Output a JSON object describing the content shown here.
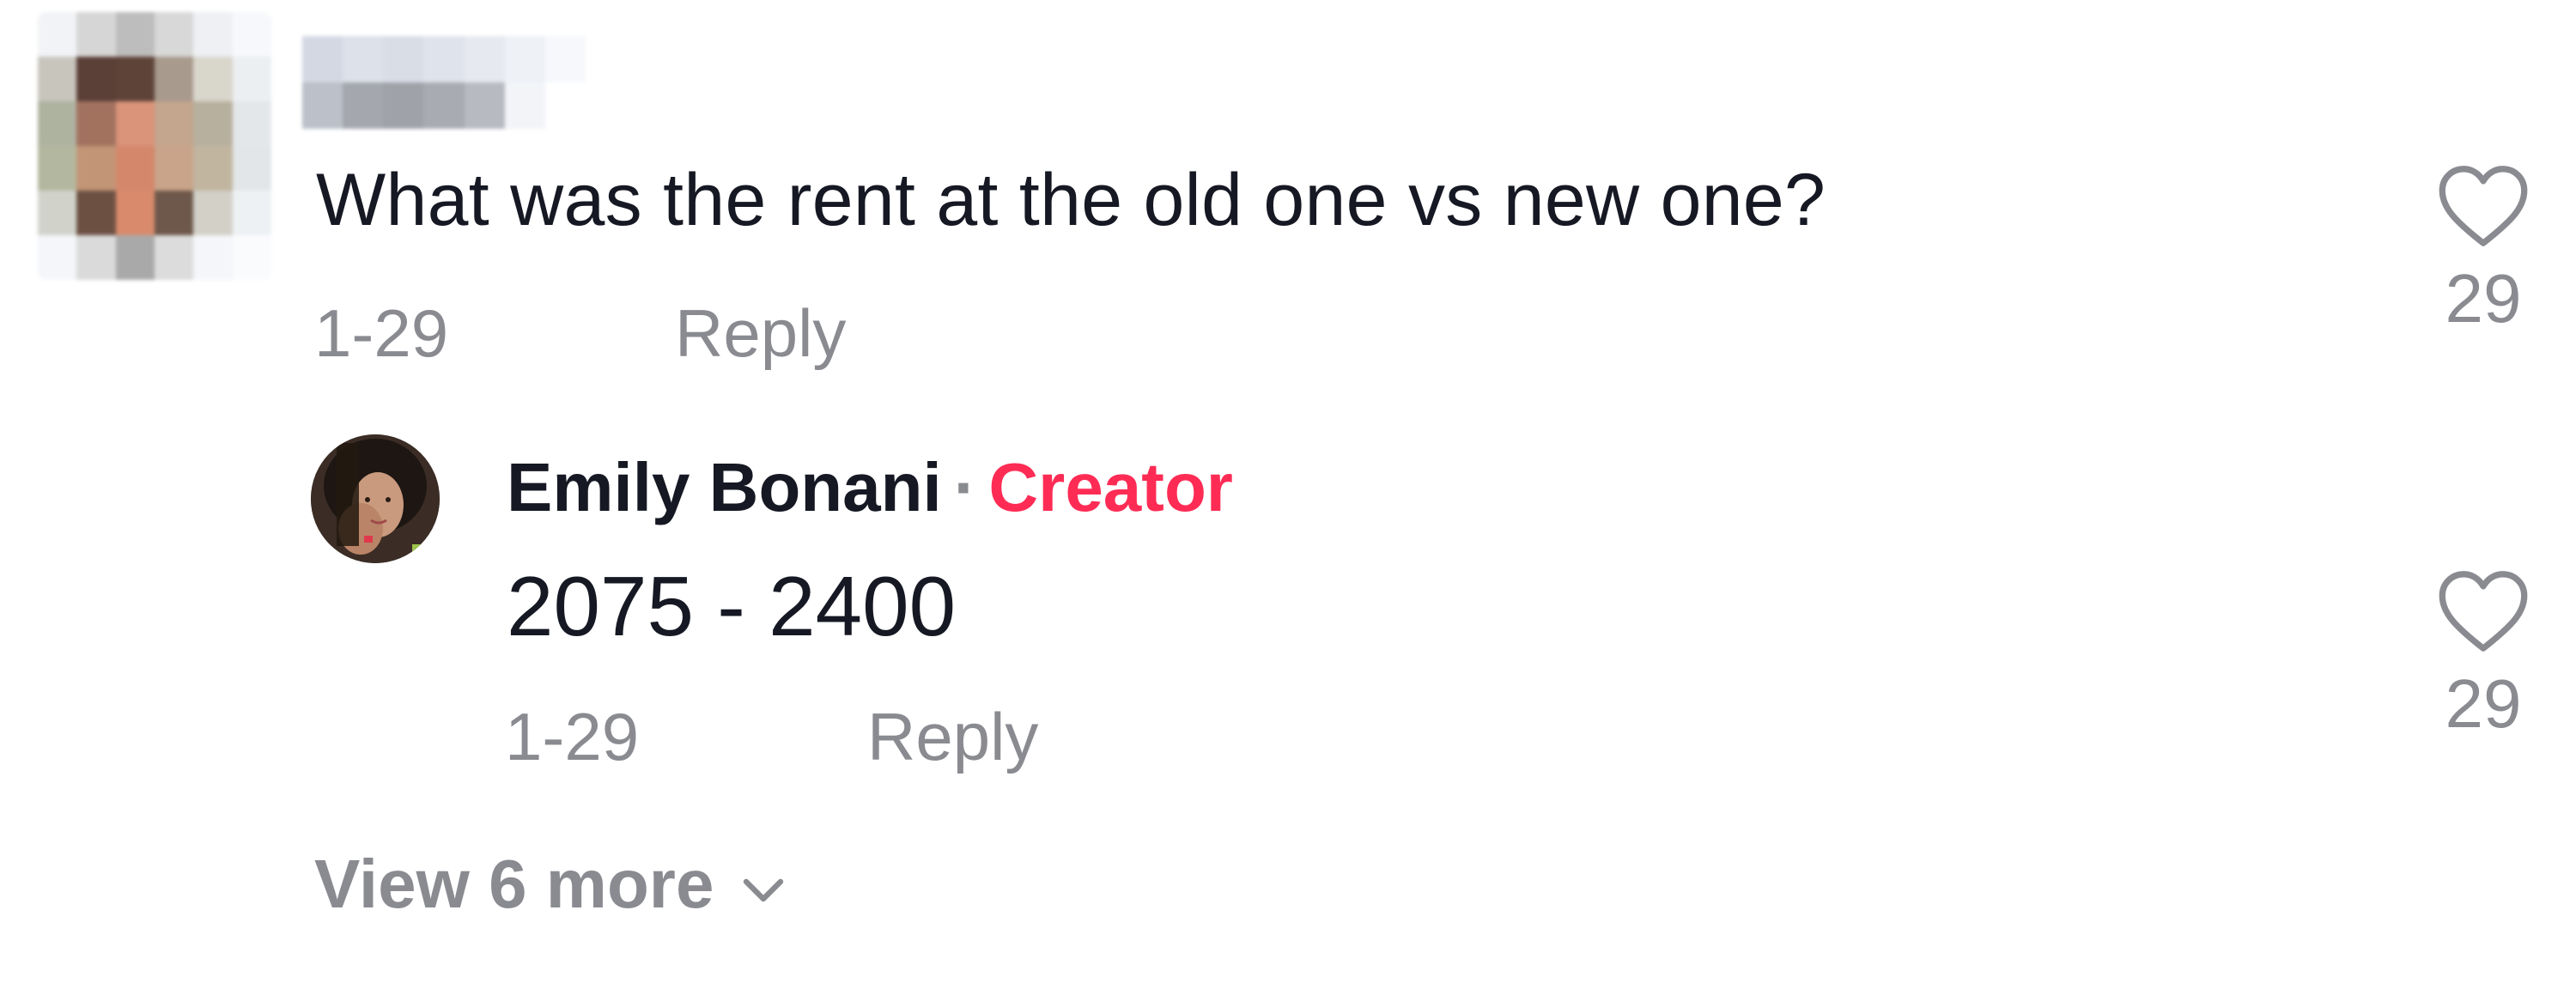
{
  "comment": {
    "avatar_icon": "pixelated-avatar",
    "username_censored": true,
    "text": "What was the rent at the old one vs new one?",
    "date": "1-29",
    "reply_label": "Reply",
    "like_icon": "heart-outline-icon",
    "like_count": "29"
  },
  "reply": {
    "avatar_icon": "profile-photo",
    "author": "Emily Bonani",
    "separator": "·",
    "badge": "Creator",
    "text": "2075 - 2400",
    "date": "1-29",
    "reply_label": "Reply",
    "like_icon": "heart-outline-icon",
    "like_count": "29"
  },
  "view_more": {
    "label": "View 6 more",
    "icon": "chevron-down-icon"
  },
  "colors": {
    "text_primary": "#161823",
    "text_secondary": "#8a8b91",
    "creator_badge": "#fe2c55",
    "background": "#ffffff"
  }
}
